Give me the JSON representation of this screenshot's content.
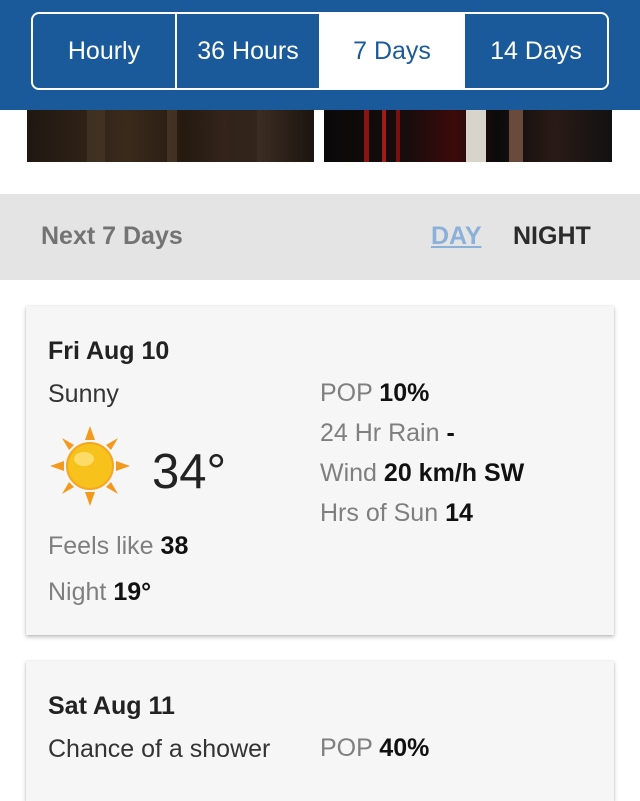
{
  "tabs": [
    {
      "label": "Hourly",
      "active": false
    },
    {
      "label": "36 Hours",
      "active": false
    },
    {
      "label": "7 Days",
      "active": true
    },
    {
      "label": "14 Days",
      "active": false
    }
  ],
  "section": {
    "title": "Next 7 Days",
    "day_toggle": "DAY",
    "night_toggle": "NIGHT"
  },
  "forecasts": [
    {
      "date": "Fri Aug 10",
      "condition": "Sunny",
      "icon": "sun-icon",
      "temperature": "34°",
      "feels_like_label": "Feels like",
      "feels_like_value": "38",
      "night_label": "Night",
      "night_value": "19°",
      "pop_label": "POP",
      "pop_value": "10%",
      "rain_label": "24 Hr Rain",
      "rain_value": "-",
      "wind_label": "Wind",
      "wind_value": "20 km/h SW",
      "sun_label": "Hrs of Sun",
      "sun_value": "14"
    },
    {
      "date": "Sat Aug 11",
      "condition": "Chance of a shower",
      "pop_label": "POP",
      "pop_value": "40%"
    }
  ],
  "colors": {
    "header_blue": "#1a5a9b",
    "day_toggle": "#8bb0da",
    "sun_yellow": "#f7c21b",
    "sun_ray": "#f39a1e"
  }
}
